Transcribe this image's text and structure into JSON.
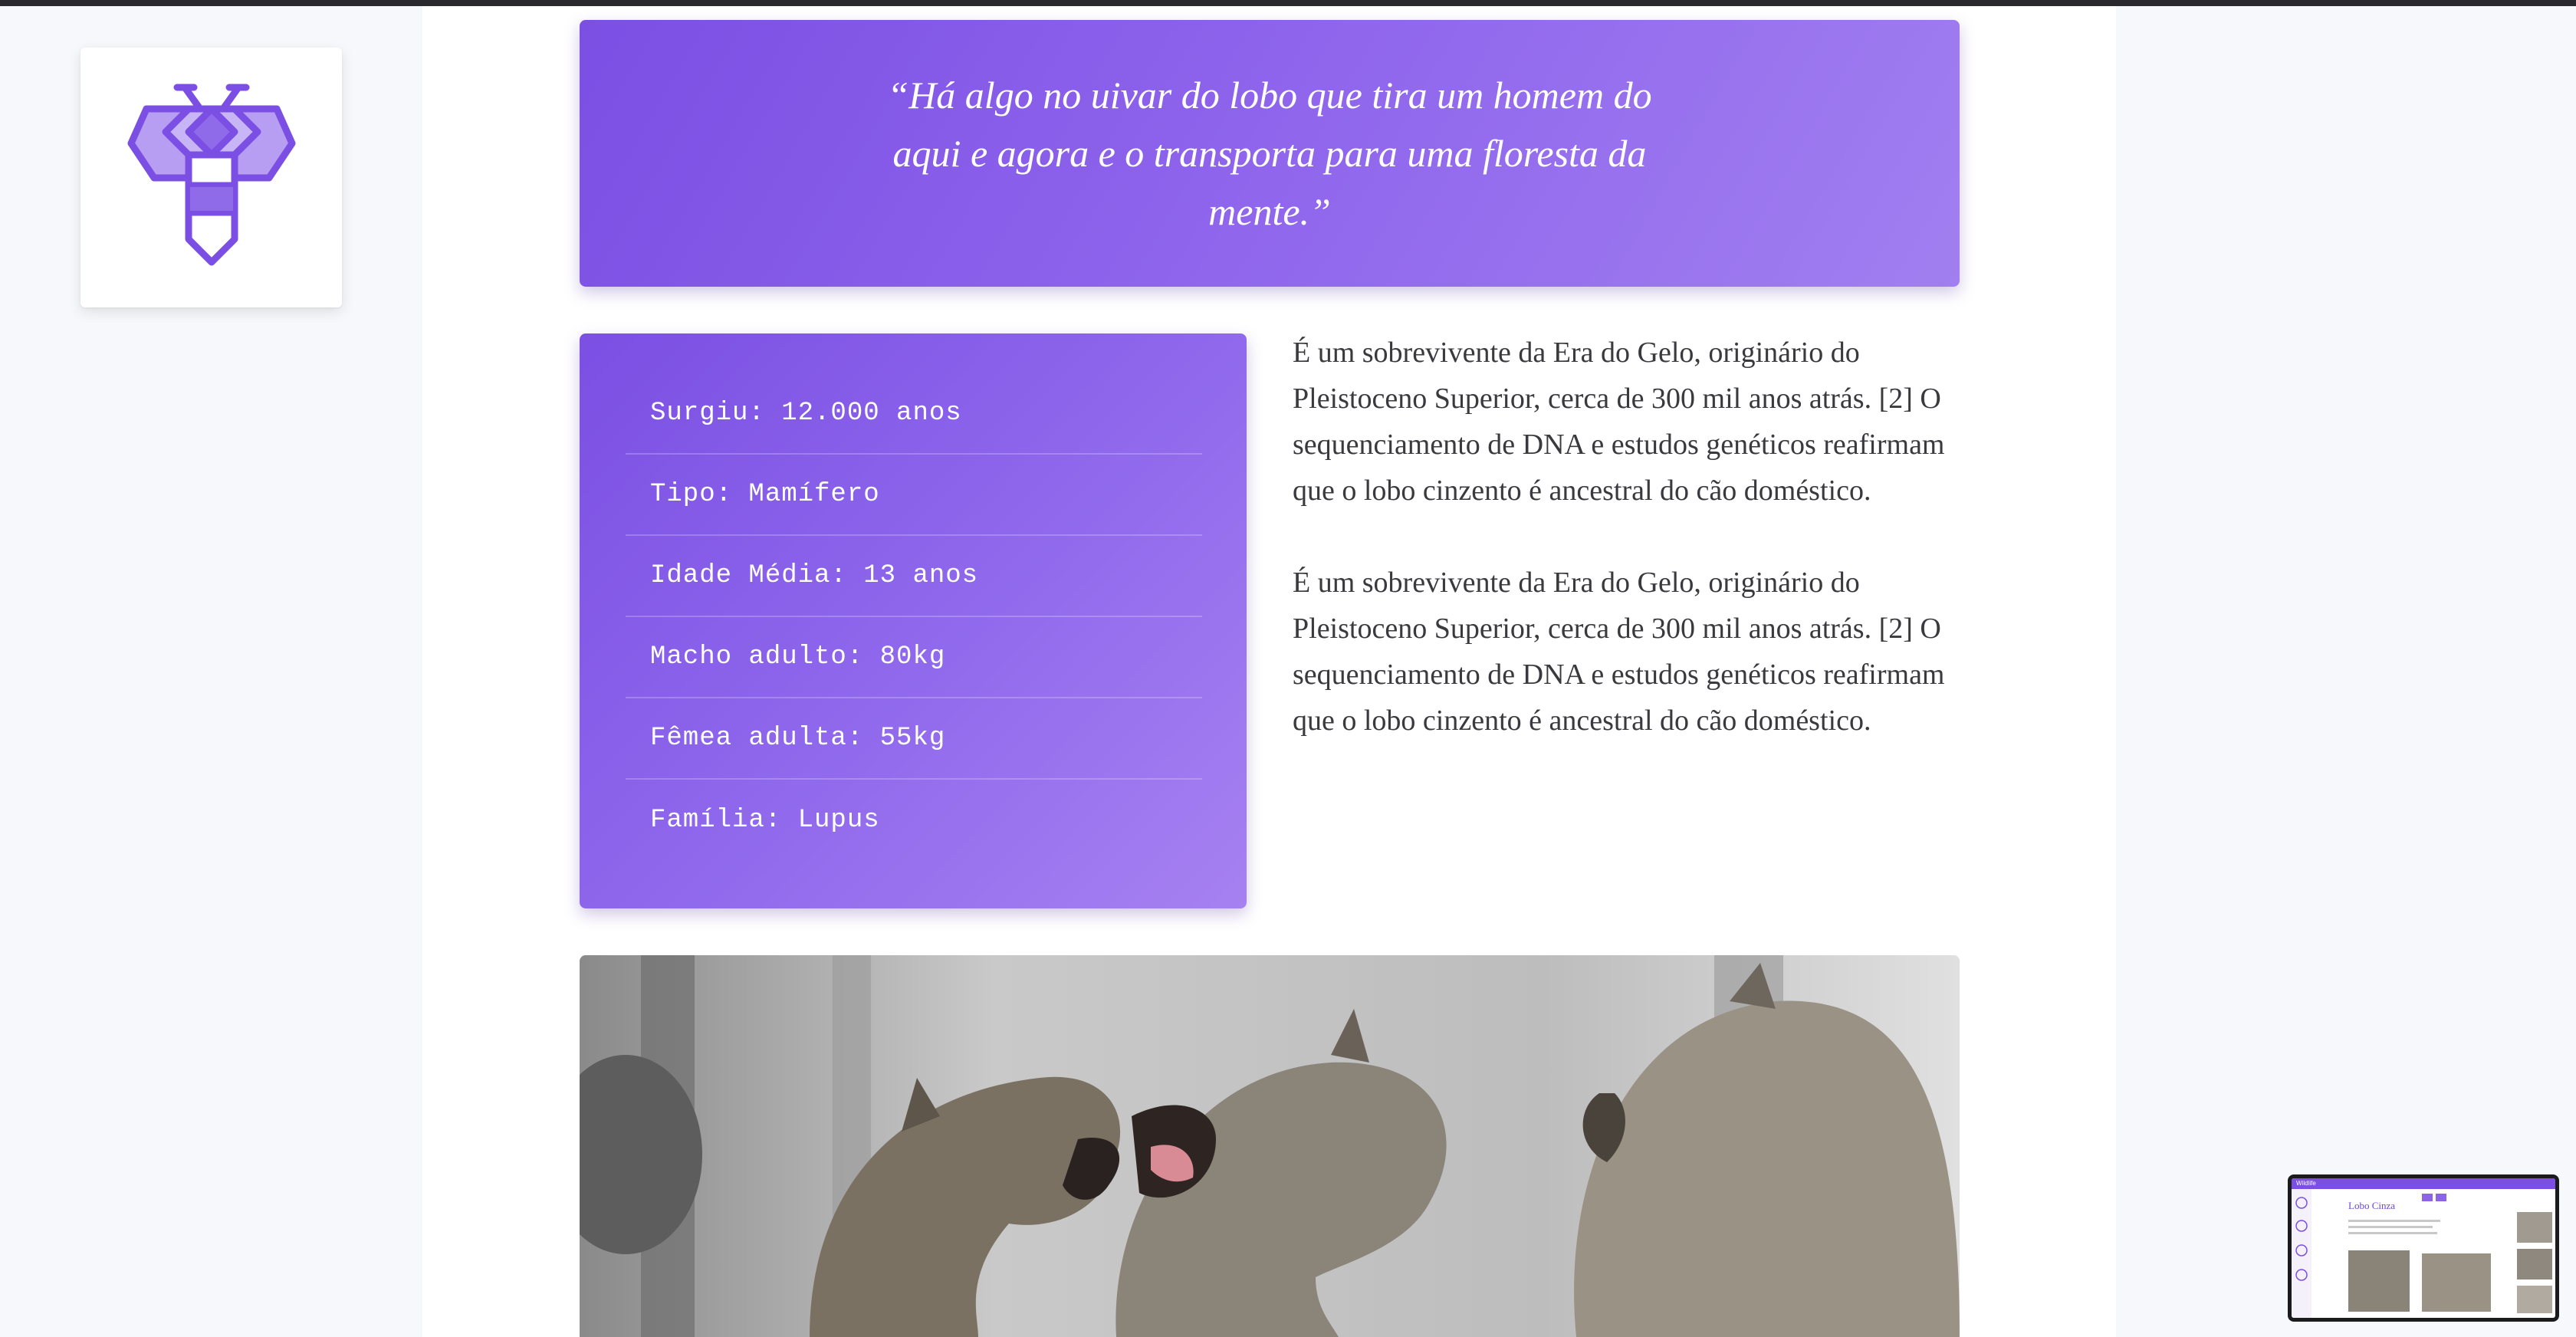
{
  "brand": {
    "logo_icon": "bee-hexagon-icon",
    "accent": "#7b4fe3"
  },
  "quote": {
    "text": "“Há algo no uivar do lobo que tira um homem do aqui e agora e o transporta para uma floresta da mente.”"
  },
  "facts": [
    "Surgiu: 12.000 anos",
    "Tipo: Mamífero",
    "Idade Média: 13 anos",
    "Macho adulto: 80kg",
    "Fêmea adulta: 55kg",
    "Família: Lupus"
  ],
  "paragraphs": [
    "É um sobrevivente da Era do Gelo, originário do Pleistoceno Superior, cerca de 300 mil anos atrás. [2] O sequenciamento de DNA e estudos genéticos reafirmam que o lobo cinzento é ancestral do cão doméstico.",
    "É um sobrevivente da Era do Gelo, originário do Pleistoceno Superior, cerca de 300 mil anos atrás. [2] O sequenciamento de DNA e estudos genéticos reafirmam que o lobo cinzento é ancestral do cão doméstico."
  ],
  "photo": {
    "subject": "wolves-howling-photo"
  },
  "preview": {
    "brand": "Wildlife",
    "title": "Lobo Cinza"
  }
}
